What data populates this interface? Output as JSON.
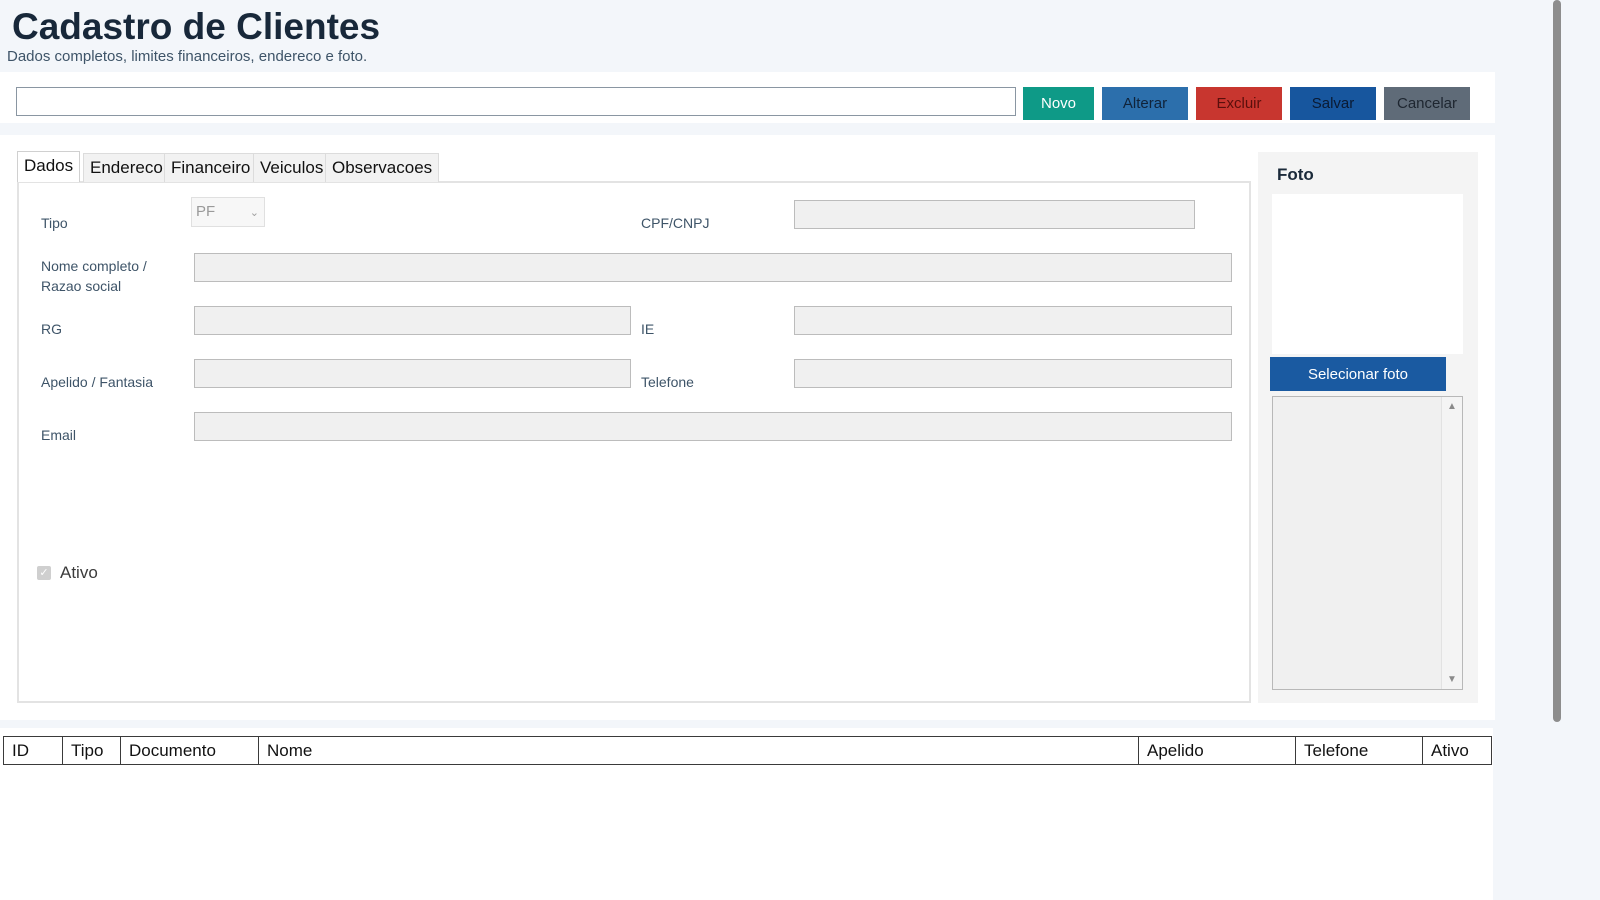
{
  "header": {
    "title": "Cadastro de Clientes",
    "subtitle": "Dados completos, limites financeiros, endereco e foto."
  },
  "toolbar": {
    "search_value": "",
    "buttons": [
      {
        "label": "Novo",
        "bg": "#0e9a87",
        "fg": "#ffffff"
      },
      {
        "label": "Alterar",
        "bg": "#2c6fac",
        "fg": "#10233a"
      },
      {
        "label": "Excluir",
        "bg": "#c8362f",
        "fg": "#5a0f0c"
      },
      {
        "label": "Salvar",
        "bg": "#17569e",
        "fg": "#0a1a33"
      },
      {
        "label": "Cancelar",
        "bg": "#5f6b78",
        "fg": "#1e2630"
      }
    ]
  },
  "tabs": [
    "Dados",
    "Endereco",
    "Financeiro",
    "Veiculos",
    "Observacoes"
  ],
  "form": {
    "tipo_label": "Tipo",
    "tipo_value": "PF",
    "cpf_label": "CPF/CNPJ",
    "nome_label_line1": "Nome completo /",
    "nome_label_line2": "Razao social",
    "rg_label": "RG",
    "ie_label": "IE",
    "apelido_label": "Apelido / Fantasia",
    "telefone_label": "Telefone",
    "email_label": "Email",
    "ativo_label": "Ativo",
    "ativo_checked": true
  },
  "photo": {
    "title": "Foto",
    "select_button": "Selecionar foto"
  },
  "grid": {
    "columns": [
      "ID",
      "Tipo",
      "Documento",
      "Nome",
      "Apelido",
      "Telefone",
      "Ativo"
    ]
  }
}
